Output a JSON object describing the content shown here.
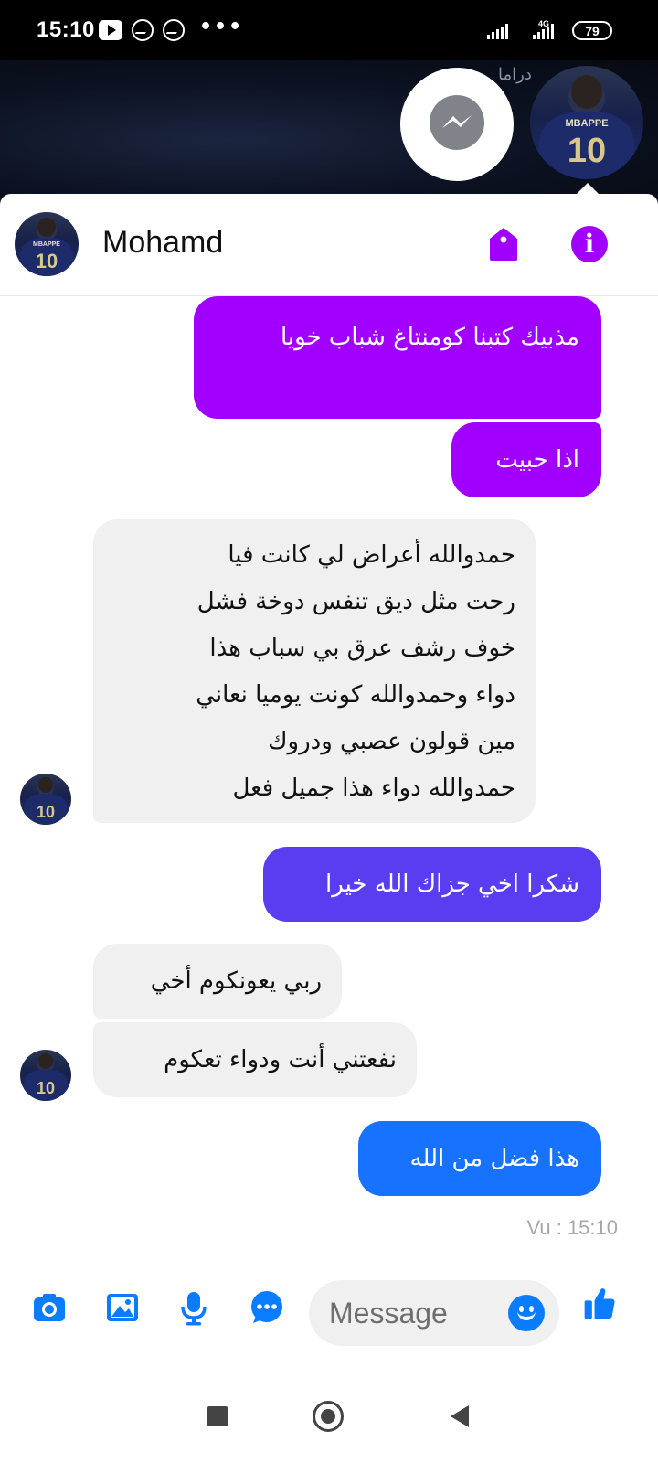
{
  "status_bar": {
    "time": "15:10",
    "battery": "79",
    "network": "4G",
    "more": "•••"
  },
  "background": {
    "partial_text": "دراما"
  },
  "chat": {
    "contact_name": "Mohamd",
    "jersey_name": "MBAPPE",
    "jersey_number": "10",
    "accent_color": "#a100ff",
    "messages": [
      {
        "from": "me",
        "text": "مذبيك كتبنا كومنتاغ شباب خويا",
        "color": "#a100ff"
      },
      {
        "from": "me",
        "text": "اذا حبيت",
        "color": "#a100ff"
      },
      {
        "from": "them",
        "lines": [
          "حمدوالله أعراض لي كانت فيا",
          "رحت مثل ديق تنفس دوخة فشل",
          "خوف رشف عرق بي سباب هذا",
          "دواء وحمدوالله كونت يوميا نعاني",
          "مين قولون عصبي ودروك",
          "حمدوالله دواء هذا جميل فعل"
        ]
      },
      {
        "from": "me",
        "text": "شكرا اخي جزاك الله خيرا",
        "color": "#5a3df0"
      },
      {
        "from": "them",
        "text": "ربي يعونكوم أخي"
      },
      {
        "from": "them",
        "text": "نفعتني أنت ودواء تعكوم"
      },
      {
        "from": "me",
        "text": "هذا فضل من الله",
        "color": "#1672ff"
      }
    ],
    "seen_status": "Vu : 15:10"
  },
  "composer": {
    "placeholder": "Message",
    "icon_color": "#0a7cff"
  }
}
